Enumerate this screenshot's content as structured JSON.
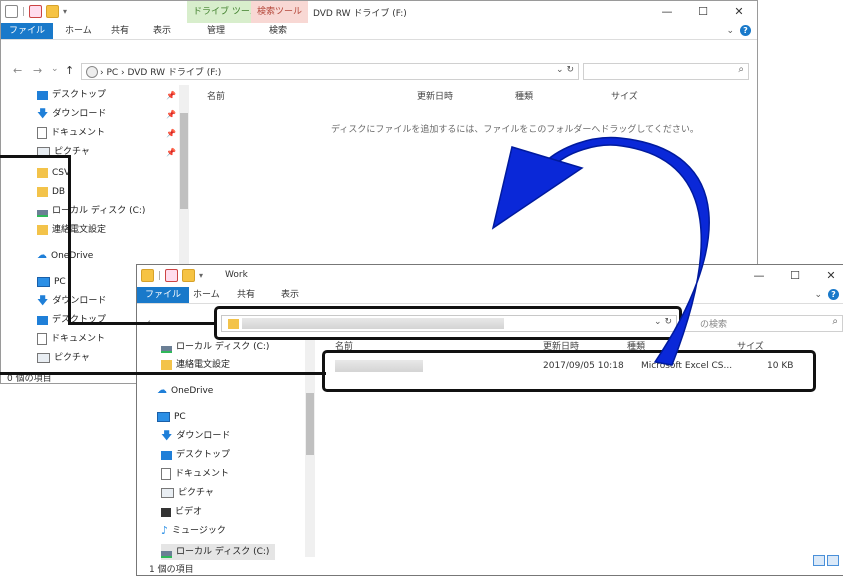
{
  "window_back": {
    "quick_access": "|",
    "context_tab_drive": "ドライブ ツール",
    "context_tab_search": "検索ツール",
    "title": "DVD RW ドライブ (F:)",
    "controls": {
      "minimize": "—",
      "maximize": "☐",
      "close": "✕"
    },
    "ribbon_tabs": [
      "ファイル",
      "ホーム",
      "共有",
      "表示",
      "管理",
      "検索"
    ],
    "nav": {
      "back": "←",
      "forward": "→",
      "dropdown": "⌄",
      "up": "↑"
    },
    "address_path": "› PC › DVD RW ドライブ (F:)",
    "address_tail": "⌄  ↻",
    "search_placeholder": "",
    "sidebar": [
      {
        "label": "デスクトップ",
        "icon": "desktop-icon",
        "pinned": true
      },
      {
        "label": "ダウンロード",
        "icon": "download-icon",
        "pinned": true
      },
      {
        "label": "ドキュメント",
        "icon": "document-icon",
        "pinned": true
      },
      {
        "label": "ピクチャ",
        "icon": "picture-icon",
        "pinned": true
      },
      {
        "label": "CSV",
        "icon": "folder-icon"
      },
      {
        "label": "DB",
        "icon": "folder-icon"
      },
      {
        "label": "ローカル ディスク (C:)",
        "icon": "drive-icon"
      },
      {
        "label": "連絡電文設定",
        "icon": "folder-icon"
      },
      {
        "label": "OneDrive",
        "icon": "onedrive-icon"
      },
      {
        "label": "PC",
        "icon": "pc-icon"
      },
      {
        "label": "ダウンロード",
        "icon": "download-icon"
      },
      {
        "label": "デスクトップ",
        "icon": "desktop-icon"
      },
      {
        "label": "ドキュメント",
        "icon": "document-icon"
      },
      {
        "label": "ピクチャ",
        "icon": "picture-icon"
      }
    ],
    "columns": [
      "名前",
      "更新日時",
      "種類",
      "サイズ"
    ],
    "empty_message": "ディスクにファイルを追加するには、ファイルをこのフォルダーへドラッグしてください。",
    "status": "0 個の項目"
  },
  "window_front": {
    "quick_access": "|",
    "title": "Work",
    "controls": {
      "minimize": "—",
      "maximize": "☐",
      "close": "✕"
    },
    "ribbon_tabs": [
      "ファイル",
      "ホーム",
      "共有",
      "表示"
    ],
    "nav": {
      "back": "←"
    },
    "address_tail": "⌄  ↻",
    "search_placeholder": "の検索",
    "sidebar": [
      {
        "label": "ローカル ディスク (C:)",
        "icon": "drive-icon"
      },
      {
        "label": "連絡電文設定",
        "icon": "folder-icon"
      },
      {
        "label": "OneDrive",
        "icon": "onedrive-icon"
      },
      {
        "label": "PC",
        "icon": "pc-icon"
      },
      {
        "label": "ダウンロード",
        "icon": "download-icon"
      },
      {
        "label": "デスクトップ",
        "icon": "desktop-icon"
      },
      {
        "label": "ドキュメント",
        "icon": "document-icon"
      },
      {
        "label": "ピクチャ",
        "icon": "picture-icon"
      },
      {
        "label": "ビデオ",
        "icon": "video-icon"
      },
      {
        "label": "ミュージック",
        "icon": "music-icon"
      },
      {
        "label": "ローカル ディスク (C:)",
        "icon": "drive-icon"
      }
    ],
    "columns": [
      "名前",
      "更新日時",
      "種類",
      "サイズ"
    ],
    "file_row": {
      "date": "2017/09/05 10:18",
      "type": "Microsoft Excel CS...",
      "size": "10 KB"
    },
    "status": "1 個の項目"
  },
  "colors": {
    "accent": "#1979ca",
    "arrow": "#0a28d8",
    "callout": "#111111"
  }
}
